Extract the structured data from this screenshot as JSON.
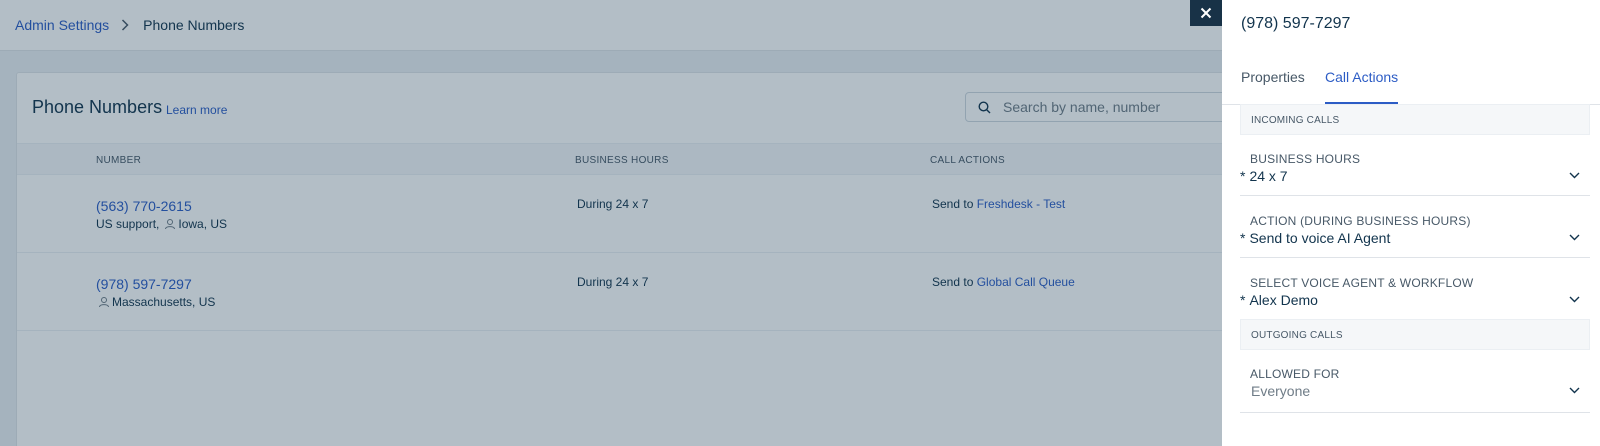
{
  "breadcrumb": {
    "parent": "Admin Settings",
    "current": "Phone Numbers"
  },
  "card": {
    "title": "Phone Numbers",
    "learn_more": "Learn more",
    "search_placeholder": "Search by name, number"
  },
  "table": {
    "headers": {
      "number": "NUMBER",
      "business_hours": "BUSINESS HOURS",
      "call_actions": "CALL ACTIONS"
    },
    "rows": [
      {
        "number": "(563) 770-2615",
        "name": "US support,",
        "location": "Iowa, US",
        "hours": "During 24 x 7",
        "action_prefix": "Send to",
        "action_target": "Freshdesk - Test"
      },
      {
        "number": "(978) 597-7297",
        "name": "",
        "location": "Massachusetts, US",
        "hours": "During 24 x 7",
        "action_prefix": "Send to",
        "action_target": "Global Call Queue"
      }
    ]
  },
  "drawer": {
    "title": "(978) 597-7297",
    "tabs": [
      "Properties",
      "Call Actions"
    ],
    "active_tab": "Call Actions",
    "incoming_section": "INCOMING CALLS",
    "outgoing_section": "OUTGOING CALLS",
    "required_marker": "*",
    "fields": {
      "business_hours": {
        "label": "BUSINESS HOURS",
        "value": "24 x 7"
      },
      "action": {
        "label": "ACTION (DURING BUSINESS HOURS)",
        "value": "Send to voice AI Agent"
      },
      "voice_agent": {
        "label": "SELECT VOICE AGENT & WORKFLOW",
        "value": "Alex Demo"
      },
      "allowed_for": {
        "label": "ALLOWED FOR",
        "placeholder": "Everyone"
      }
    }
  },
  "colors": {
    "link": "#2c5cc5",
    "text": "#12344d",
    "close_button": "#183247"
  },
  "icons": [
    "chevron-right-icon",
    "search-icon",
    "location-icon",
    "close-icon",
    "chevron-down-icon"
  ]
}
